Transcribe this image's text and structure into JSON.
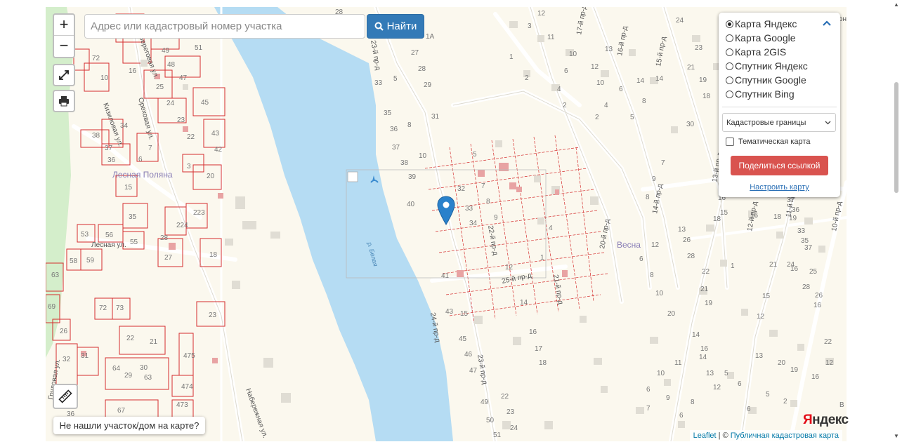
{
  "search": {
    "placeholder": "Адрес или кадастровый номер участка",
    "button_label": "Найти"
  },
  "zoom": {
    "in_label": "+",
    "out_label": "−"
  },
  "icons": {
    "search": "search-icon",
    "fullscreen": "fullscreen-icon",
    "print": "print-icon",
    "ruler": "ruler-icon",
    "collapse": "chevron-up-icon",
    "marker": "map-marker-icon",
    "water": "water-icon"
  },
  "layers": {
    "base": [
      {
        "label": "Карта Яндекс",
        "selected": true
      },
      {
        "label": "Карта Google",
        "selected": false
      },
      {
        "label": "Карта 2GIS",
        "selected": false
      },
      {
        "label": "Спутник Яндекс",
        "selected": false
      },
      {
        "label": "Спутник Google",
        "selected": false
      },
      {
        "label": "Спутник Bing",
        "selected": false
      }
    ],
    "overlay_select": "Кадастровые границы",
    "thematic_label": "Тематическая карта",
    "thematic_checked": false,
    "share_button": "Поделиться ссылкой",
    "settings_link": "Настроить карту"
  },
  "not_found_button": "Не нашли участок/дом на карте?",
  "attribution": {
    "leaflet": "Leaflet",
    "separator": " | © ",
    "source": "Публичная кадастровая карта"
  },
  "yandex_logo": {
    "first": "Я",
    "rest": "ндекс"
  },
  "map_labels": {
    "settlement_1": "Лесная Поляна",
    "settlement_2": "Весна",
    "river": "р. Белая",
    "streets": [
      "Ореховая ул.",
      "Лесная ул.",
      "Кизиловая ул.",
      "Набережная ул.",
      "Береговая ул.",
      "23-й пр-д",
      "22-й пр-д",
      "24-й пр-д",
      "25-й пр-д",
      "21-й пр-д",
      "20-й пр-д",
      "17-й пр-д",
      "16-й пр-д",
      "15-й пр-д",
      "14-й пр-д",
      "13-й пр-д",
      "12-й пр-д",
      "11-й пр-д",
      "10-й пр-д",
      "Грудовая ул.",
      "ул. Гон"
    ],
    "house_numbers": [
      "28",
      "27",
      "28",
      "29",
      "33",
      "35",
      "36",
      "37",
      "38",
      "39",
      "40",
      "31",
      "32",
      "33",
      "34",
      "41",
      "43",
      "45",
      "46",
      "47",
      "49",
      "50",
      "51",
      "72",
      "10",
      "16",
      "49",
      "48",
      "47",
      "51",
      "25",
      "24",
      "23",
      "22",
      "45",
      "43",
      "42",
      "34",
      "38",
      "37",
      "7",
      "6",
      "3",
      "20",
      "15",
      "35",
      "223",
      "224",
      "28",
      "27",
      "18",
      "53",
      "56",
      "55",
      "58",
      "59",
      "63",
      "69",
      "26",
      "72",
      "73",
      "22",
      "21",
      "23",
      "32",
      "31",
      "64",
      "29",
      "30",
      "63",
      "475",
      "474",
      "473",
      "67",
      "36",
      "5",
      "7",
      "8",
      "9",
      "12",
      "14",
      "16",
      "17",
      "18",
      "22",
      "23",
      "24",
      "1A",
      "1",
      "2",
      "3",
      "4",
      "5",
      "6",
      "7",
      "8",
      "9",
      "10",
      "11",
      "12",
      "13",
      "14",
      "15",
      "17",
      "18",
      "19",
      "20",
      "21",
      "22",
      "23",
      "24",
      "25",
      "26",
      "27",
      "28",
      "29",
      "30",
      "31",
      "32",
      "33",
      "35",
      "37"
    ]
  }
}
